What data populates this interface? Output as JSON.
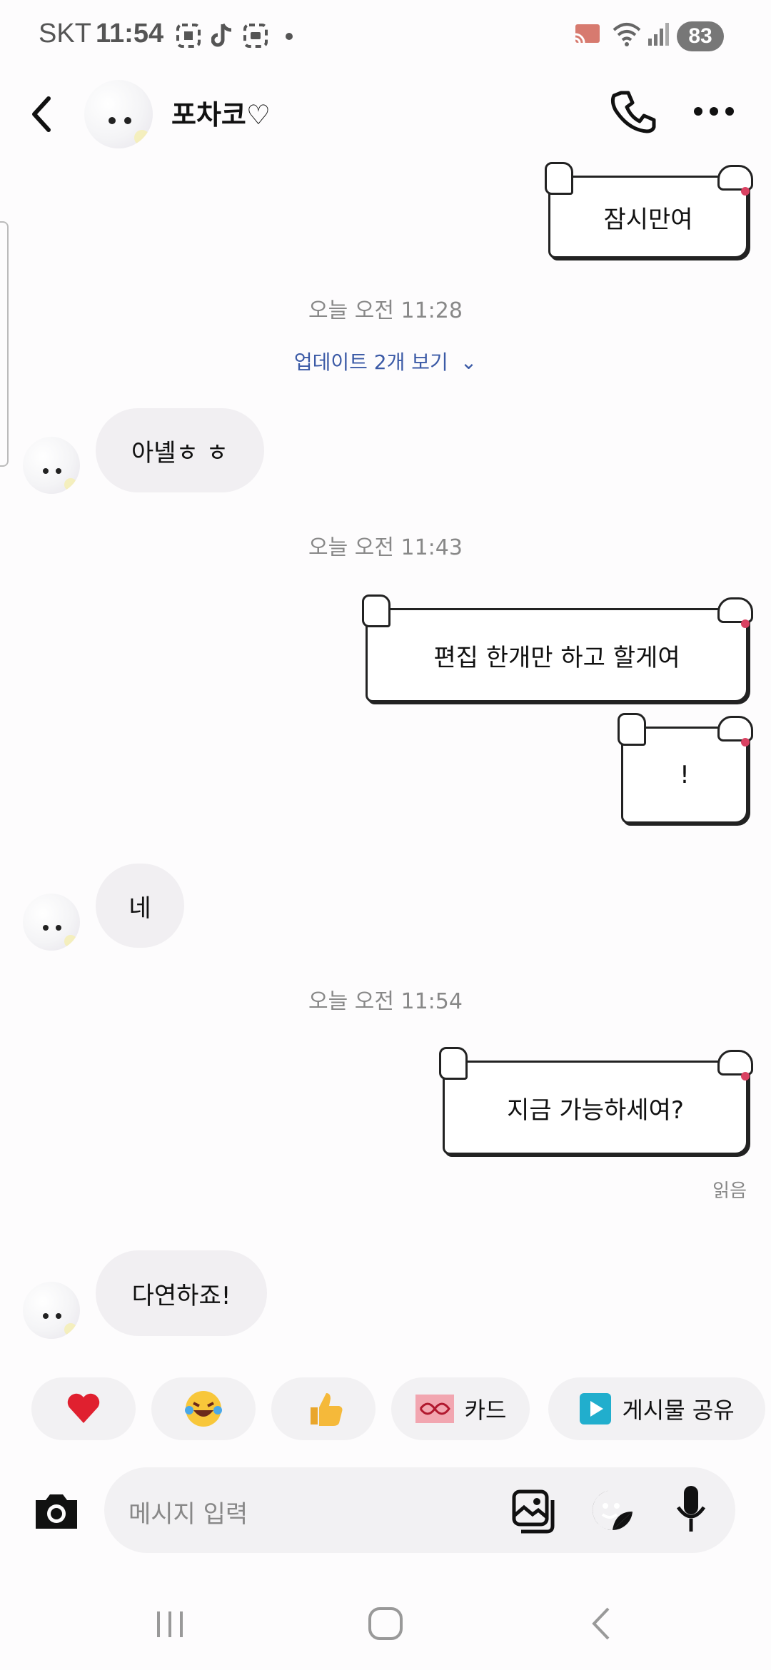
{
  "status_bar": {
    "carrier": "SKT",
    "time": "11:54",
    "battery": "83"
  },
  "header": {
    "contact_name": "포차코♡"
  },
  "messages": {
    "m0": "잠시만여",
    "ts1": "오늘 오전 11:28",
    "updates": "업데이트 2개 보기",
    "m1": "아녤ㅎ ㅎ",
    "ts2": "오늘 오전 11:43",
    "m2": "편집 한개만 하고 할게여",
    "m3": "!",
    "m4": "네",
    "ts3": "오늘 오전 11:54",
    "m5": "지금 가능하세여?",
    "read_receipt": "읽음",
    "m6": "다연하죠!"
  },
  "quick_actions": {
    "card_label": "카드",
    "share_label": "게시물 공유"
  },
  "input": {
    "placeholder": "메시지 입력"
  },
  "colors": {
    "accent_link": "#3b5aa6",
    "bubble": "#f1eff2",
    "heart": "#e0202f"
  }
}
